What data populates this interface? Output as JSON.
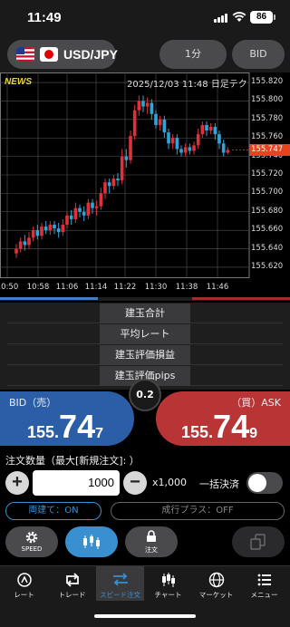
{
  "status_bar": {
    "time": "11:49",
    "battery": "86"
  },
  "header": {
    "pair": "USD/JPY",
    "timeframe": "1分",
    "price_side": "BID"
  },
  "chart_data": {
    "type": "candlestick",
    "news_label": "NEWS",
    "info": "2025/12/03 11:48 日足テク",
    "y_ticks": [
      "155.820",
      "155.800",
      "155.780",
      "155.760",
      "155.740",
      "155.720",
      "155.700",
      "155.680",
      "155.660",
      "155.640",
      "155.620"
    ],
    "x_ticks": [
      "10:50",
      "10:58",
      "11:06",
      "11:14",
      "11:22",
      "11:30",
      "11:38",
      "11:46"
    ],
    "ylim": [
      155.615,
      155.825
    ],
    "current_price": "155.747",
    "candles": [
      [
        155.635,
        155.64,
        155.63,
        155.645
      ],
      [
        155.64,
        155.648,
        155.636,
        155.652
      ],
      [
        155.648,
        155.644,
        155.638,
        155.655
      ],
      [
        155.644,
        155.652,
        155.64,
        155.658
      ],
      [
        155.652,
        155.66,
        155.648,
        155.664
      ],
      [
        155.66,
        155.654,
        155.65,
        155.666
      ],
      [
        155.654,
        155.664,
        155.65,
        155.668
      ],
      [
        155.664,
        155.66,
        155.656,
        155.67
      ],
      [
        155.66,
        155.666,
        155.655,
        155.67
      ],
      [
        155.666,
        155.662,
        155.656,
        155.67
      ],
      [
        155.662,
        155.658,
        155.652,
        155.668
      ],
      [
        155.658,
        155.666,
        155.654,
        155.672
      ],
      [
        155.666,
        155.676,
        155.662,
        155.68
      ],
      [
        155.676,
        155.672,
        155.666,
        155.682
      ],
      [
        155.672,
        155.684,
        155.668,
        155.69
      ],
      [
        155.684,
        155.68,
        155.674,
        155.688
      ],
      [
        155.68,
        155.676,
        155.67,
        155.686
      ],
      [
        155.676,
        155.69,
        155.672,
        155.694
      ],
      [
        155.69,
        155.684,
        155.678,
        155.694
      ],
      [
        155.684,
        155.686,
        155.676,
        155.692
      ],
      [
        155.686,
        155.7,
        155.682,
        155.706
      ],
      [
        155.7,
        155.712,
        155.694,
        155.716
      ],
      [
        155.712,
        155.708,
        155.7,
        155.716
      ],
      [
        155.708,
        155.716,
        155.704,
        155.72
      ],
      [
        155.716,
        155.714,
        155.708,
        155.722
      ],
      [
        155.714,
        155.74,
        155.71,
        155.748
      ],
      [
        155.74,
        155.736,
        155.728,
        155.748
      ],
      [
        155.736,
        155.762,
        155.732,
        155.768
      ],
      [
        155.762,
        155.79,
        155.758,
        155.796
      ],
      [
        155.79,
        155.8,
        155.784,
        155.806
      ],
      [
        155.8,
        155.794,
        155.788,
        155.806
      ],
      [
        155.794,
        155.798,
        155.786,
        155.804
      ],
      [
        155.798,
        155.786,
        155.78,
        155.802
      ],
      [
        155.786,
        155.774,
        155.77,
        155.79
      ],
      [
        155.774,
        155.78,
        155.768,
        155.784
      ],
      [
        155.78,
        155.766,
        155.76,
        155.784
      ],
      [
        155.766,
        155.754,
        155.748,
        155.77
      ],
      [
        155.754,
        155.76,
        155.748,
        155.764
      ],
      [
        155.76,
        155.748,
        155.742,
        155.764
      ],
      [
        155.748,
        155.744,
        155.74,
        155.752
      ],
      [
        155.744,
        155.75,
        155.74,
        155.754
      ],
      [
        155.75,
        155.746,
        155.742,
        155.754
      ],
      [
        155.746,
        155.752,
        155.742,
        155.756
      ],
      [
        155.752,
        155.764,
        155.748,
        155.77
      ],
      [
        155.764,
        155.774,
        155.76,
        155.778
      ],
      [
        155.774,
        155.768,
        155.762,
        155.778
      ],
      [
        155.768,
        155.772,
        155.764,
        155.776
      ],
      [
        155.772,
        155.764,
        155.758,
        155.776
      ],
      [
        155.764,
        155.754,
        155.748,
        155.768
      ],
      [
        155.754,
        155.744,
        155.74,
        155.758
      ],
      [
        155.744,
        155.747,
        155.742,
        155.75
      ]
    ]
  },
  "stats": {
    "items": [
      "建玉合計",
      "平均レート",
      "建玉評価損益",
      "建玉評価pips"
    ]
  },
  "bid": {
    "label": "BID（売）",
    "pre": "155.",
    "big": "74",
    "small": "7"
  },
  "ask": {
    "label": "（買）ASK",
    "pre": "155.",
    "big": "74",
    "small": "9"
  },
  "spread": "0.2",
  "order": {
    "qty_label": "注文数量（最大[新規注文]: ）",
    "qty_value": "1000",
    "multiplier": "x1,000",
    "bulk_label": "一括決済",
    "both_label": "両建て：ON",
    "market_label": "成行プラス：OFF"
  },
  "actions": {
    "speed": "SPEED",
    "order": "注文"
  },
  "nav": {
    "items": [
      "レート",
      "トレード",
      "スピード注文",
      "チャート",
      "マーケット",
      "メニュー"
    ]
  },
  "colors": {
    "bid": "#2c5ea8",
    "ask": "#b93535",
    "up": "#e0303a",
    "down": "#2fa4d8",
    "accent": "#3a8fd0"
  }
}
